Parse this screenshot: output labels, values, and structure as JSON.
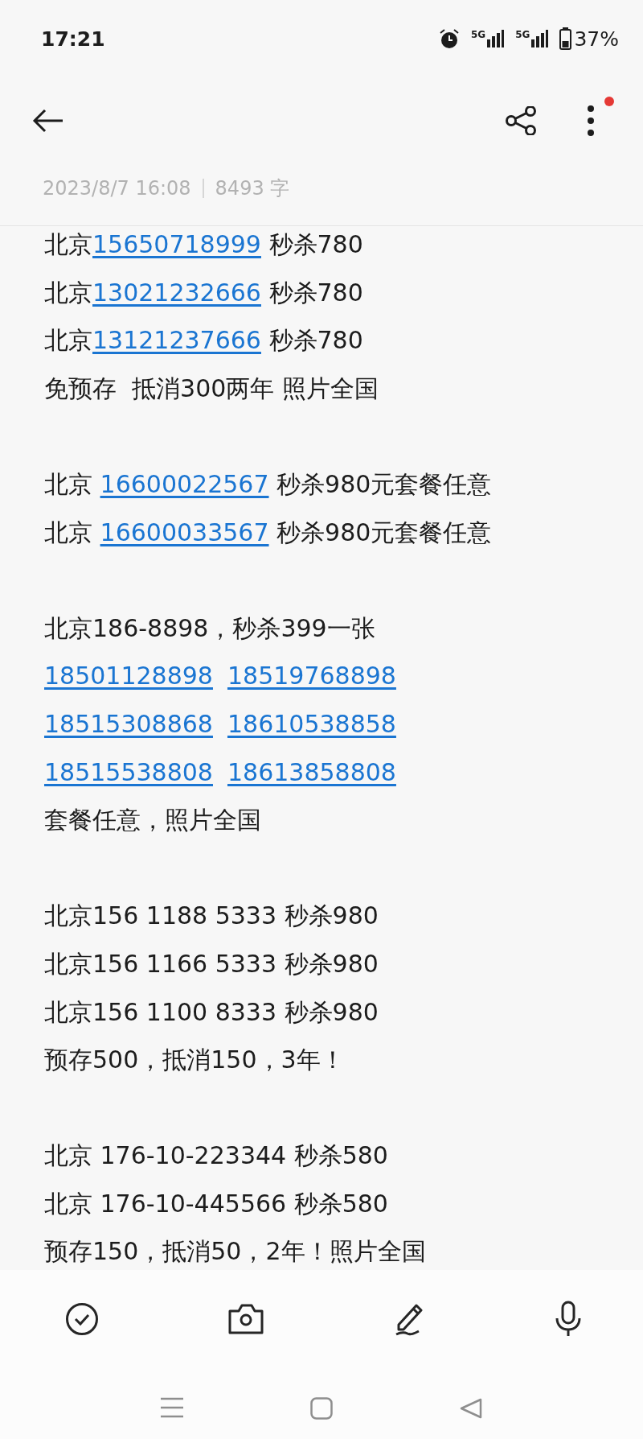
{
  "status_bar": {
    "time": "17:21",
    "signals": [
      {
        "label": "5G"
      },
      {
        "label": "5G"
      }
    ],
    "battery": "37%"
  },
  "note": {
    "date": "2023/8/7 16:08",
    "word_count": "8493 字",
    "lines": [
      {
        "kind": "text",
        "parts": [
          {
            "kind": "text",
            "text": "北京"
          },
          {
            "kind": "link",
            "text": "15650718999"
          },
          {
            "kind": "text",
            "text": " 秒杀780"
          }
        ]
      },
      {
        "kind": "text",
        "parts": [
          {
            "kind": "text",
            "text": "北京"
          },
          {
            "kind": "link",
            "text": "13021232666"
          },
          {
            "kind": "text",
            "text": " 秒杀780"
          }
        ]
      },
      {
        "kind": "text",
        "parts": [
          {
            "kind": "text",
            "text": "北京"
          },
          {
            "kind": "link",
            "text": "13121237666"
          },
          {
            "kind": "text",
            "text": " 秒杀780"
          }
        ]
      },
      {
        "kind": "text",
        "parts": [
          {
            "kind": "text",
            "text": "免预存  抵消300两年 照片全国"
          }
        ]
      },
      {
        "kind": "blank"
      },
      {
        "kind": "text",
        "parts": [
          {
            "kind": "text",
            "text": "北京 "
          },
          {
            "kind": "link",
            "text": "16600022567"
          },
          {
            "kind": "text",
            "text": " 秒杀980元套餐任意"
          }
        ]
      },
      {
        "kind": "text",
        "parts": [
          {
            "kind": "text",
            "text": "北京 "
          },
          {
            "kind": "link",
            "text": "16600033567"
          },
          {
            "kind": "text",
            "text": " 秒杀980元套餐任意"
          }
        ]
      },
      {
        "kind": "blank"
      },
      {
        "kind": "text",
        "parts": [
          {
            "kind": "text",
            "text": "北京186-8898，秒杀399一张"
          }
        ]
      },
      {
        "kind": "text",
        "parts": [
          {
            "kind": "link",
            "text": "18501128898"
          },
          {
            "kind": "link",
            "text": "18519768898"
          }
        ]
      },
      {
        "kind": "text",
        "parts": [
          {
            "kind": "link",
            "text": "18515308868"
          },
          {
            "kind": "link",
            "text": "18610538858"
          }
        ]
      },
      {
        "kind": "text",
        "parts": [
          {
            "kind": "link",
            "text": "18515538808"
          },
          {
            "kind": "link",
            "text": "18613858808"
          }
        ]
      },
      {
        "kind": "text",
        "parts": [
          {
            "kind": "text",
            "text": "套餐任意，照片全国"
          }
        ]
      },
      {
        "kind": "blank"
      },
      {
        "kind": "text",
        "parts": [
          {
            "kind": "text",
            "text": "北京156 1188 5333 秒杀980"
          }
        ]
      },
      {
        "kind": "text",
        "parts": [
          {
            "kind": "text",
            "text": "北京156 1166 5333 秒杀980"
          }
        ]
      },
      {
        "kind": "text",
        "parts": [
          {
            "kind": "text",
            "text": "北京156 1100 8333 秒杀980"
          }
        ]
      },
      {
        "kind": "text",
        "parts": [
          {
            "kind": "text",
            "text": "预存500，抵消150，3年！"
          }
        ]
      },
      {
        "kind": "blank"
      },
      {
        "kind": "text",
        "parts": [
          {
            "kind": "text",
            "text": "北京 176-10-223344 秒杀580"
          }
        ]
      },
      {
        "kind": "text",
        "parts": [
          {
            "kind": "text",
            "text": "北京 176-10-445566 秒杀580"
          }
        ]
      },
      {
        "kind": "text",
        "parts": [
          {
            "kind": "text",
            "text": "预存150，抵消50，2年！照片全国"
          }
        ]
      }
    ]
  }
}
